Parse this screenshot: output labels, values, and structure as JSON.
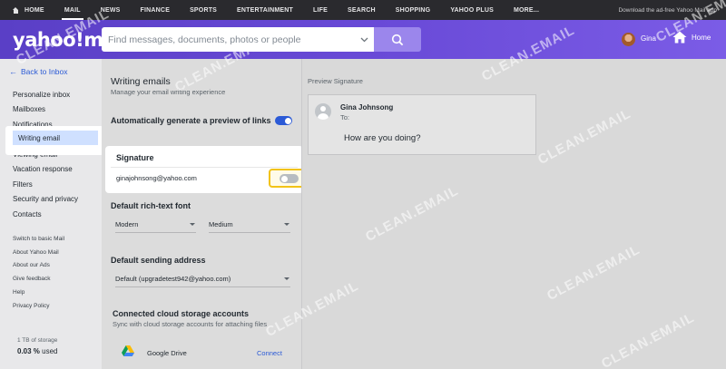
{
  "topnav": {
    "items": [
      "HOME",
      "MAIL",
      "NEWS",
      "FINANCE",
      "SPORTS",
      "ENTERTAINMENT",
      "LIFE",
      "SEARCH",
      "SHOPPING",
      "YAHOO PLUS",
      "MORE..."
    ],
    "active": "MAIL",
    "adfree_text": "Download the ad-free Yahoo Mail app"
  },
  "header": {
    "logo": "yahoo!mail",
    "search_placeholder": "Find messages, documents, photos or people",
    "user_name": "Gina",
    "home_label": "Home"
  },
  "sidebar": {
    "back_label": "Back to Inbox",
    "items": [
      "Personalize inbox",
      "Mailboxes",
      "Notifications",
      "Writing email",
      "Viewing email",
      "Vacation response",
      "Filters",
      "Security and privacy",
      "Contacts"
    ],
    "active_item": "Writing email",
    "secondary": [
      "Switch to basic Mail",
      "About Yahoo Mail",
      "About our Ads",
      "Give feedback",
      "Help",
      "Privacy Policy"
    ],
    "storage_label": "1 TB of storage",
    "storage_used_value": "0.03 %",
    "storage_used_suffix": "used"
  },
  "settings": {
    "title": "Writing emails",
    "subtitle": "Manage your email writing experience",
    "preview_links_label": "Automatically generate a preview of links",
    "preview_links_enabled": true,
    "signature": {
      "title": "Signature",
      "email": "ginajohnsong@yahoo.com",
      "enabled": false
    },
    "font": {
      "title": "Default rich-text font",
      "face": "Modern",
      "size": "Medium"
    },
    "sending": {
      "title": "Default sending address",
      "address": "Default (upgradetest942@yahoo.com)"
    },
    "cloud": {
      "title": "Connected cloud storage accounts",
      "subtitle": "Sync with cloud storage accounts for attaching files",
      "provider": "Google Drive",
      "action": "Connect"
    }
  },
  "preview": {
    "label": "Preview Signature",
    "name": "Gina Johnsong",
    "to_label": "To:",
    "body": "How are you doing?"
  },
  "watermark": "CLEAN.EMAIL",
  "colors": {
    "accent_blue": "#2b5ad6",
    "header_purple": "#5a3fc6",
    "focus_yellow": "#f2c317"
  }
}
